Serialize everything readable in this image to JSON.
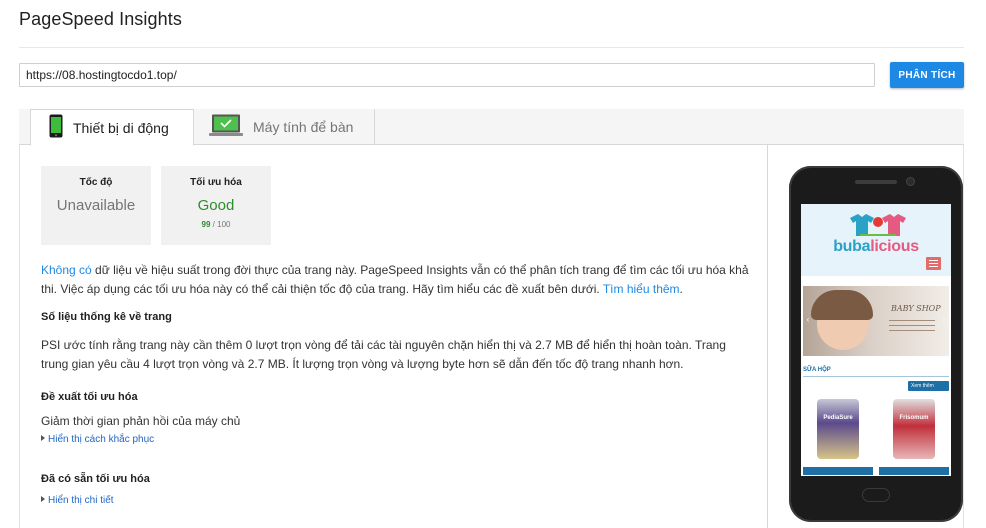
{
  "app": {
    "title": "PageSpeed Insights"
  },
  "search": {
    "url_value": "https://08.hostingtocdo1.top/",
    "analyze_label": "PHÂN TÍCH"
  },
  "tabs": [
    {
      "label": "Thiết bị di động",
      "icon": "mobile-phone-icon",
      "active": true
    },
    {
      "label": "Máy tính để bàn",
      "icon": "desktop-monitor-icon",
      "active": false
    }
  ],
  "scores": {
    "speed": {
      "title": "Tốc độ",
      "value": "Unavailable"
    },
    "optimization": {
      "title": "Tối ưu hóa",
      "value": "Good",
      "score": "99",
      "max": "/ 100"
    }
  },
  "intro": {
    "link_no_data": "Không có",
    "text": " dữ liệu về hiệu suất trong đời thực của trang này. PageSpeed Insights vẫn có thể phân tích trang để tìm các tối ưu hóa khả thi. Việc áp dụng các tối ưu hóa này có thể cải thiện tốc độ của trang. Hãy tìm hiểu các đề xuất bên dưới. ",
    "link_learn_more": "Tìm hiểu thêm",
    "end": "."
  },
  "stats": {
    "heading": "Số liệu thống kê về trang",
    "text": "PSI ước tính rằng trang này cần thêm 0 lượt trọn vòng để tải các tài nguyên chặn hiển thị và 2.7 MB để hiển thị hoàn toàn. Trang trung gian yêu cầu 4 lượt trọn vòng và 2.7 MB. Ít lượng trọn vòng và lượng byte hơn sẽ dẫn đến tốc độ trang nhanh hơn."
  },
  "suggestions": {
    "heading": "Đề xuất tối ưu hóa",
    "item": "Giảm thời gian phản hồi của máy chủ",
    "toggle": "Hiển thị cách khắc phục"
  },
  "available": {
    "heading": "Đã có sẵn tối ưu hóa",
    "toggle": "Hiển thị chi tiết"
  },
  "preview": {
    "logo_part1": "buba",
    "logo_part2": "licious",
    "banner_text": "BABY SHOP",
    "section_label": "SỮA HỘP",
    "view_more": "Xem thêm",
    "product_1_label": "PediaSure",
    "product_2_label": "Frisomum"
  },
  "colors": {
    "accent": "#1e88e5",
    "good": "#2e8b2e",
    "phone_body": "#1b1b1b"
  }
}
